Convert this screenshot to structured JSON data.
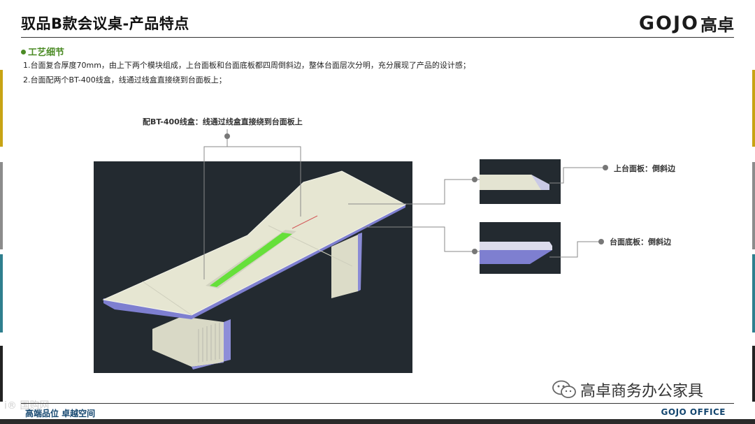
{
  "header": {
    "title": "驭品B款会议桌-产品特点",
    "logo_latin": "GOJO",
    "logo_cn": "高卓"
  },
  "section": {
    "heading": "工艺细节",
    "lines": [
      "1.台面复合厚度70mm，由上下两个模块组成，上台面板和台面底板都四周倒斜边，整体台面层次分明，充分展现了产品的设计感；",
      "2.台面配两个BT-400线盒，线通过线盒直接绕到台面板上；"
    ]
  },
  "callouts": {
    "wire_box": "配BT-400线盒：线通过线盒直接绕到台面板上",
    "top_panel": "上台面板：倒斜边",
    "bottom_panel": "台面底板：倒斜边"
  },
  "footer": {
    "left": "高端品位 卓越空间",
    "right": "GOJO OFFICE",
    "wechat": "高卓商务办公家具",
    "watermark": "i® 国购网"
  },
  "colors": {
    "accent_green": "#4b8b25",
    "footer_blue": "#14466f",
    "drawing_bg": "#232a30",
    "tabletop": "#e6e6d2",
    "wire_slot": "#66e03a",
    "edge_purple": "#7e7fd0"
  }
}
